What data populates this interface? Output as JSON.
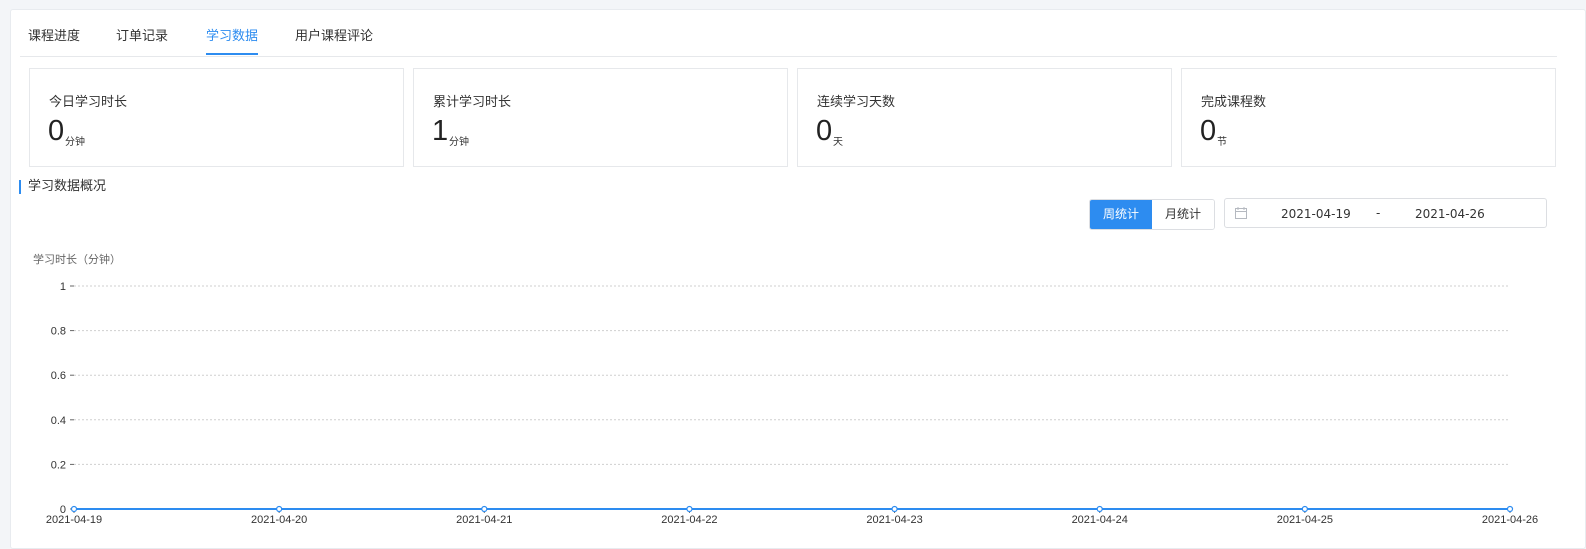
{
  "tabs": [
    {
      "label": "课程进度"
    },
    {
      "label": "订单记录"
    },
    {
      "label": "学习数据",
      "active": true
    },
    {
      "label": "用户课程评论"
    }
  ],
  "stats": [
    {
      "label": "今日学习时长",
      "value": "0",
      "unit": "分钟"
    },
    {
      "label": "累计学习时长",
      "value": "1",
      "unit": "分钟"
    },
    {
      "label": "连续学习天数",
      "value": "0",
      "unit": "天"
    },
    {
      "label": "完成课程数",
      "value": "0",
      "unit": "节"
    }
  ],
  "section": {
    "title": "学习数据概况"
  },
  "toggle": {
    "week": "周统计",
    "month": "月统计",
    "selected": "周统计"
  },
  "date_range": {
    "start": "2021-04-19",
    "separator": "-",
    "end": "2021-04-26",
    "icon": "calendar-icon"
  },
  "colors": {
    "accent": "#2d8cf0"
  },
  "chart_data": {
    "type": "line",
    "ylabel": "学习时长（分钟）",
    "x": [
      "2021-04-19",
      "2021-04-20",
      "2021-04-21",
      "2021-04-22",
      "2021-04-23",
      "2021-04-24",
      "2021-04-25",
      "2021-04-26"
    ],
    "series": [
      {
        "values": [
          0,
          0,
          0,
          0,
          0,
          0,
          0,
          0
        ]
      }
    ],
    "ylim": [
      0,
      1
    ],
    "yticks": [
      "0",
      "0.2",
      "0.4",
      "0.6",
      "0.8",
      "1"
    ],
    "grid": true
  }
}
